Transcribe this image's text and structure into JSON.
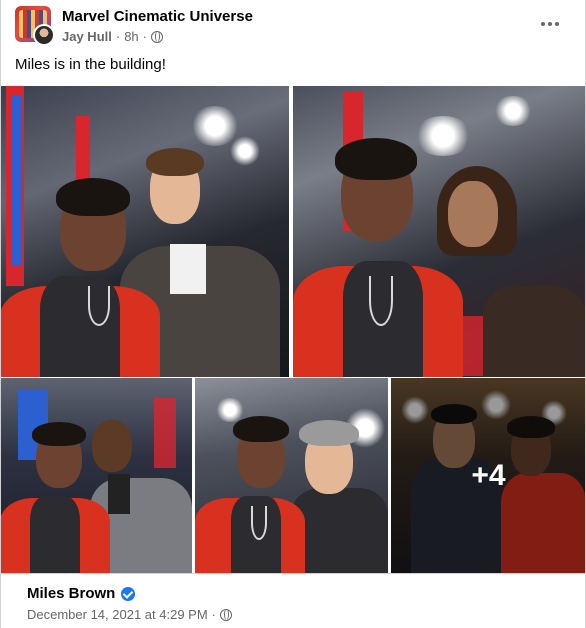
{
  "post": {
    "group_name": "Marvel Cinematic Universe",
    "author": "Jay Hull",
    "time": "8h",
    "separator": "·",
    "text": "Miles is in the building!",
    "more_overlay": "+4"
  },
  "footer": {
    "name": "Miles Brown",
    "date": "December 14, 2021 at 4:29 PM",
    "separator": "·"
  },
  "icons": {
    "privacy": "globe-icon",
    "verified": "verified-badge-icon",
    "menu": "more-options-icon"
  },
  "colors": {
    "link_blue": "#1877f2",
    "secondary_text": "#65676b",
    "jacket_red": "#d8311f"
  }
}
